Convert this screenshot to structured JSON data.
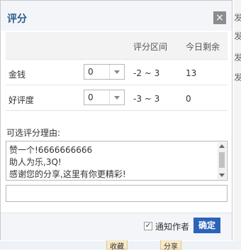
{
  "dialog": {
    "title": "评分",
    "close_glyph": "×"
  },
  "table": {
    "headers": {
      "range": "评分区间",
      "today": "今日剩余"
    },
    "rows": [
      {
        "label": "金钱",
        "value": "0",
        "range": "-2 ~ 3",
        "today": "13"
      },
      {
        "label": "好评度",
        "value": "0",
        "range": "-3 ~ 3",
        "today": "0"
      }
    ]
  },
  "reasons": {
    "label": "可选评分理由:",
    "items": [
      "赞一个!6666666666",
      "助人为乐,3Q!",
      "感谢您的分享,这里有你更精彩!"
    ],
    "input_value": ""
  },
  "footer": {
    "notify_label": "通知作者",
    "notify_checked": true,
    "confirm_label": "确定"
  },
  "background": {
    "side_chars": [
      "发",
      "发",
      "发",
      "发"
    ],
    "bottom_buttons": [
      "收藏",
      "分享"
    ]
  },
  "colors": {
    "accent": "#2b63b8",
    "title": "#2b5b8c",
    "header_bg": "#f3f5f9"
  }
}
